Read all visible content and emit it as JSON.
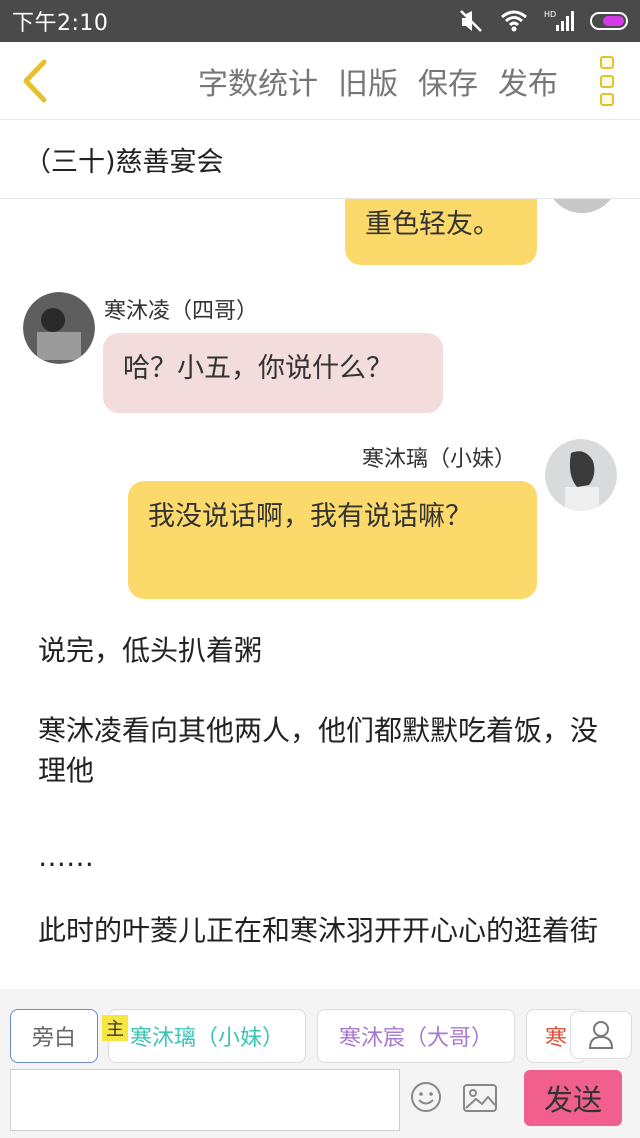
{
  "status_bar": {
    "time": "下午2:10",
    "signal_label": "HD"
  },
  "toolbar": {
    "actions": [
      "字数统计",
      "旧版",
      "保存",
      "发布"
    ]
  },
  "chapter": {
    "title": "（三十)慈善宴会"
  },
  "messages": [
    {
      "text": "重色轻友。"
    },
    {
      "speaker": "寒沐凌（四哥）",
      "text": "哈？小五，你说什么？"
    },
    {
      "speaker": "寒沐璃（小妹）",
      "text": "我没说话啊，我有说话嘛？"
    }
  ],
  "narration": [
    "说完，低头扒着粥",
    "寒沐凌看向其他两人，他们都默默吃着饭，没理他",
    "……",
    "此时的叶菱儿正在和寒沐羽开开心心的逛着街"
  ],
  "roles": {
    "host_badge": "主",
    "items": [
      "旁白",
      "寒沐璃（小妹）",
      "寒沐宸（大哥）",
      "寒"
    ]
  },
  "input": {
    "placeholder": "",
    "send_label": "发送"
  },
  "colors": {
    "yellow_bubble": "#fbd96a",
    "pink_bubble": "#f2dcdc",
    "send": "#f05f8e"
  }
}
